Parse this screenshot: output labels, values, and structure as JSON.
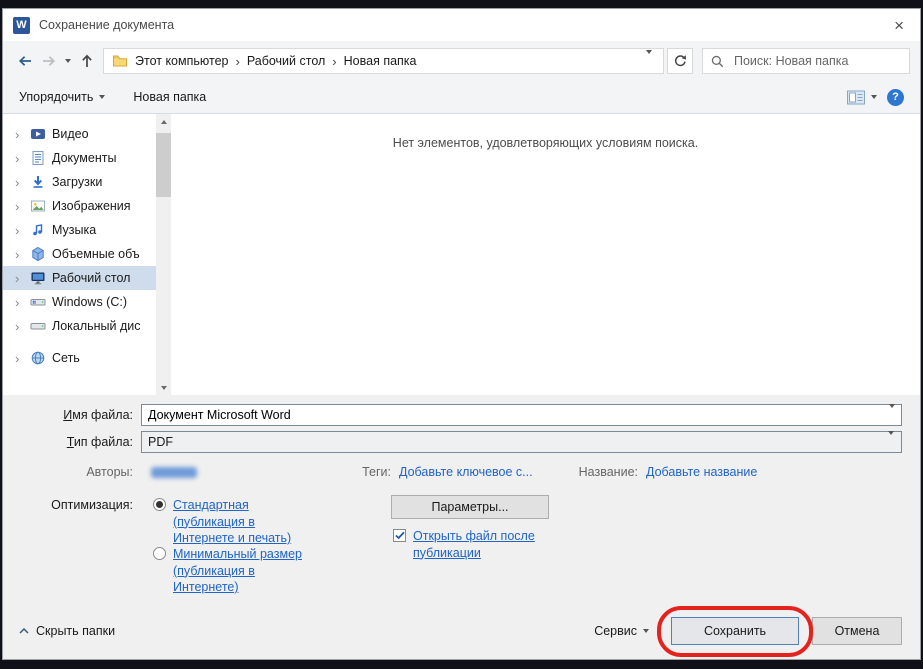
{
  "window": {
    "title": "Сохранение документа"
  },
  "glyphs": {
    "close": "×",
    "crumb_separator": "›",
    "side_chevron": "›"
  },
  "nav": {
    "breadcrumb": [
      "Этот компьютер",
      "Рабочий стол",
      "Новая папка"
    ],
    "search_placeholder": "Поиск: Новая папка"
  },
  "toolbar": {
    "organize_label": "Упорядочить",
    "new_folder_label": "Новая папка"
  },
  "sidebar": {
    "items": [
      {
        "label": "Видео"
      },
      {
        "label": "Документы"
      },
      {
        "label": "Загрузки"
      },
      {
        "label": "Изображения"
      },
      {
        "label": "Музыка"
      },
      {
        "label": "Объемные объ"
      },
      {
        "label": "Рабочий стол"
      },
      {
        "label": "Windows (C:)"
      },
      {
        "label": "Локальный дис"
      },
      {
        "label": "Сеть"
      }
    ],
    "selected_index": 6
  },
  "content": {
    "empty_message": "Нет элементов, удовлетворяющих условиям поиска."
  },
  "form": {
    "filename_label": "Имя файла:",
    "filename_value": "Документ Microsoft Word",
    "filetype_label": "Тип файла:",
    "filetype_value": "PDF",
    "authors_label": "Авторы:",
    "tags_label": "Теги:",
    "tags_add_link": "Добавьте ключевое с...",
    "title_label": "Название:",
    "title_add_link": "Добавьте название",
    "optimization_label": "Оптимизация:",
    "optimization_options": [
      {
        "label": "Стандартная (публикация в Интернете и печать)",
        "selected": true
      },
      {
        "label": "Минимальный размер (публикация в Интернете)",
        "selected": false
      }
    ],
    "options_button_label": "Параметры...",
    "open_after_publish_label": "Открыть файл после публикации",
    "open_after_publish_checked": true
  },
  "footer": {
    "hide_folders_label": "Скрыть папки",
    "tools_label": "Сервис",
    "save_label": "Сохранить",
    "cancel_label": "Отмена"
  },
  "colors": {
    "link_blue": "#2064c8",
    "word_brand_blue": "#2b579a",
    "annotation_red": "#e5231e",
    "selection_bg": "#cfdceb"
  }
}
